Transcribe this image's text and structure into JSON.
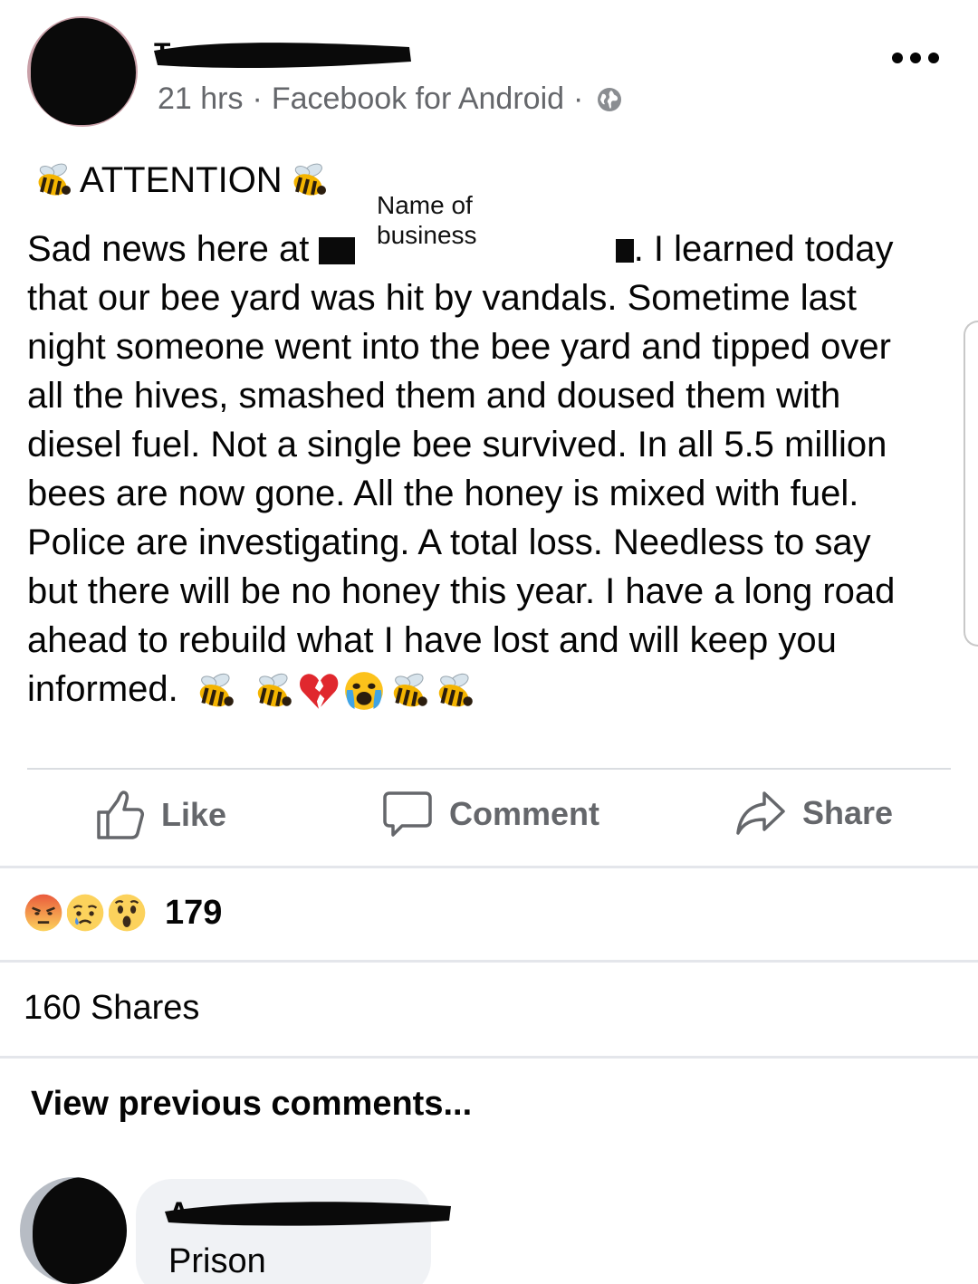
{
  "post": {
    "author_initial": "T",
    "time": "21 hrs",
    "source": "Facebook for Android",
    "separator": "·",
    "audience_icon": "globe-icon",
    "more_icon": "more-options-icon",
    "heading": "ATTENTION",
    "annotation": "Name of business",
    "annotation_line1": "Name of",
    "annotation_line2": "business",
    "body_lines": [
      "that our bee yard was hit by vandals. Sometime last",
      "night someone went into the bee yard and tipped over",
      "all the hives, smashed them and doused them with",
      "diesel fuel. Not a single bee survived. In all 5.5 million",
      "bees are now gone. All the honey is mixed with fuel.",
      "Police are investigating. A total loss. Needless to say",
      "but there will be no honey this year. I have a long road",
      "ahead to rebuild what I have lost and will keep you"
    ],
    "first_line_start": "Sad news here at",
    "first_line_end": ". I learned today",
    "last_line": "informed.",
    "emoji_icons": [
      "bee-emoji",
      "bee-emoji",
      "broken-heart-emoji",
      "crying-face-emoji",
      "bee-emoji",
      "bee-emoji"
    ]
  },
  "actions": {
    "like": "Like",
    "comment": "Comment",
    "share": "Share"
  },
  "reactions": {
    "types": [
      "angry",
      "sad",
      "wow"
    ],
    "count": "179"
  },
  "shares_text": "160 Shares",
  "view_previous": "View previous comments...",
  "comment": {
    "author_initial": "A",
    "text": "Prison"
  },
  "colors": {
    "secondary_text": "#65676b",
    "divider": "#e4e6eb",
    "bubble": "#f0f2f5"
  }
}
